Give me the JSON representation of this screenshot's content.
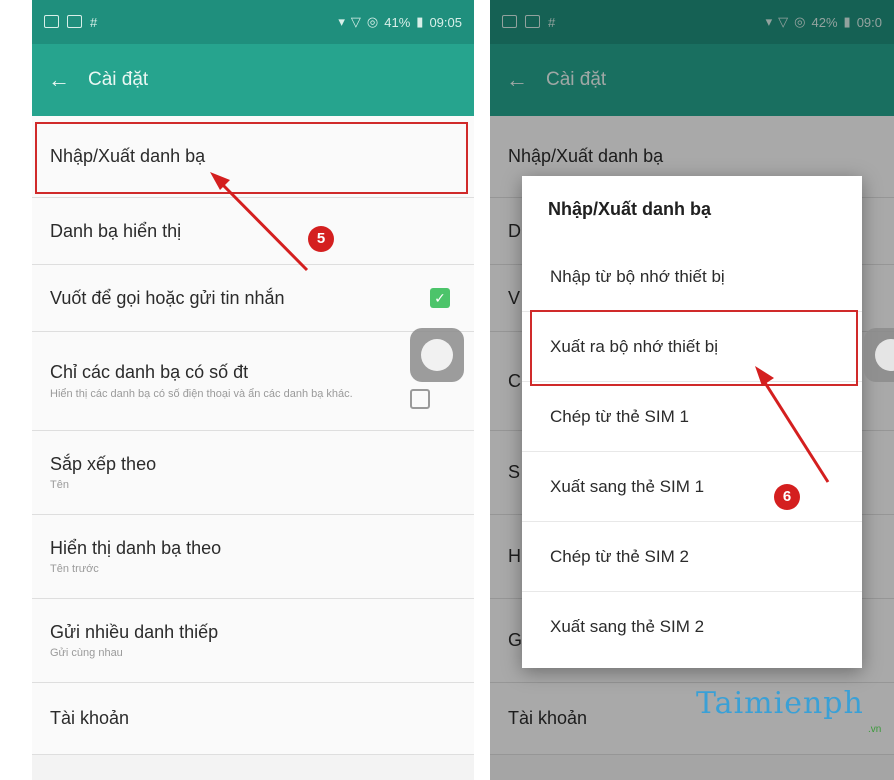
{
  "status_left": {
    "time": "09:05",
    "battery": "41%"
  },
  "status_right": {
    "time": "09:0",
    "battery": "42%"
  },
  "status_hash": "#",
  "appbar": {
    "back": "←",
    "title": "Cài đặt"
  },
  "left_list": [
    {
      "title": "Nhập/Xuất danh bạ",
      "subtitle": ""
    },
    {
      "title": "Danh bạ hiển thị",
      "subtitle": ""
    },
    {
      "title": "Vuốt để gọi hoặc gửi tin nhắn",
      "subtitle": ""
    },
    {
      "title": "Chỉ các danh bạ có số đt",
      "subtitle": "Hiển thị các danh bạ có số điện thoại và ẩn các danh bạ khác."
    },
    {
      "title": "Sắp xếp theo",
      "subtitle": "Tên"
    },
    {
      "title": "Hiển thị danh bạ theo",
      "subtitle": "Tên trước"
    },
    {
      "title": "Gửi nhiều danh thiếp",
      "subtitle": "Gửi cùng nhau"
    },
    {
      "title": "Tài khoản",
      "subtitle": ""
    }
  ],
  "right_bg": {
    "first": "Nhập/Xuất danh bạ",
    "last": "Tài khoản",
    "initials": [
      "D",
      "V",
      "C",
      "S",
      "H",
      "G"
    ]
  },
  "dialog": {
    "title": "Nhập/Xuất danh bạ",
    "options": [
      "Nhập từ bộ nhớ thiết bị",
      "Xuất ra bộ nhớ thiết bị",
      "Chép từ thẻ SIM 1",
      "Xuất sang thẻ SIM 1",
      "Chép từ thẻ SIM 2",
      "Xuất sang thẻ SIM 2"
    ]
  },
  "annotations": {
    "step5": "5",
    "step6": "6"
  },
  "watermark": {
    "text": "Taimienph",
    "suffix": ".vn"
  },
  "colors": {
    "appbar": "#26a48e",
    "statusbar": "#1f8f7d",
    "highlight": "#d02a2a",
    "checkbox": "#4cc46a"
  }
}
